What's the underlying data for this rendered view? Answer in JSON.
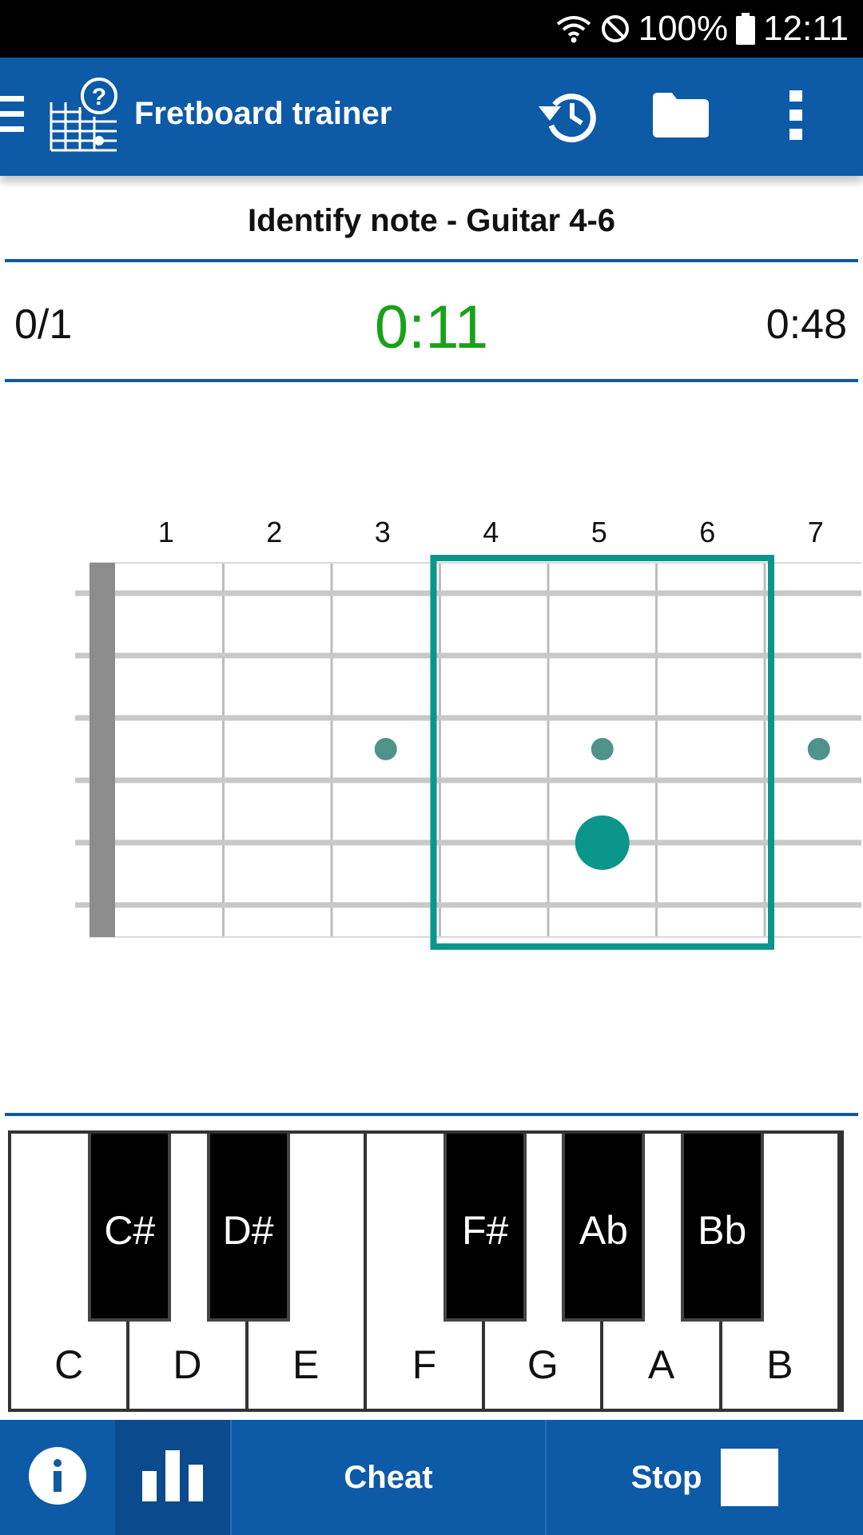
{
  "status_bar": {
    "battery": "100%",
    "time": "12:11",
    "icons": [
      "wifi-icon",
      "do-not-disturb-icon",
      "battery-icon"
    ]
  },
  "app_bar": {
    "title": "Fretboard trainer",
    "icons": [
      "menu-icon",
      "fretboard-question-logo",
      "history-icon",
      "folder-icon",
      "more-vert-icon"
    ]
  },
  "exercise": {
    "title": "Identify note - Guitar 4-6",
    "score": "0/1",
    "timer": "0:11",
    "total_time": "0:48"
  },
  "fretboard": {
    "fret_numbers": [
      "1",
      "2",
      "3",
      "4",
      "5",
      "6",
      "7"
    ],
    "highlighted_frets": [
      4,
      6
    ],
    "inlay_frets": [
      3,
      5,
      7
    ],
    "target": {
      "fret": 5,
      "string": 5
    },
    "colors": {
      "accent": "#0a968a",
      "inlay": "#4e9389",
      "string": "#c8c8c8",
      "nut": "#8c8c8c"
    }
  },
  "piano": {
    "white_keys": [
      "C",
      "D",
      "E",
      "F",
      "G",
      "A",
      "B"
    ],
    "black_keys": [
      "C#",
      "D#",
      "F#",
      "Ab",
      "Bb"
    ]
  },
  "bottom_bar": {
    "info_icon": "info-icon",
    "stats_icon": "bar-chart-icon",
    "cheat_label": "Cheat",
    "stop_label": "Stop"
  },
  "colors": {
    "primary": "#0d5aa7",
    "primary_dark": "#0b4a8c",
    "timer": "#1aa11a"
  }
}
